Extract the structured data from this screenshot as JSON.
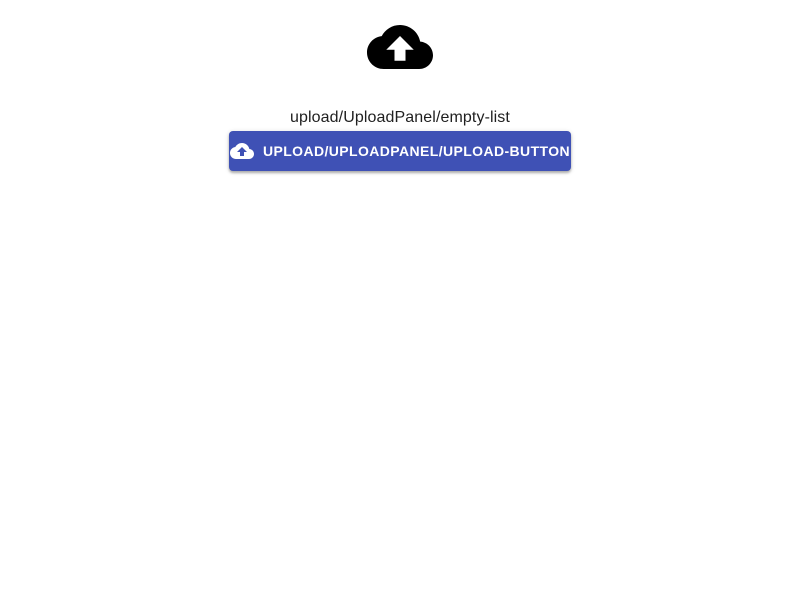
{
  "panel": {
    "icon": "cloud-upload-icon",
    "empty_text": "upload/UploadPanel/empty-list",
    "upload_button": {
      "icon": "cloud-upload-icon",
      "label": "UPLOAD/UPLOADPANEL/UPLOAD-BUTTON"
    }
  },
  "colors": {
    "primary": "#3f51b5",
    "icon": "#000000",
    "text": "#1f1f1f",
    "background": "#ffffff"
  }
}
